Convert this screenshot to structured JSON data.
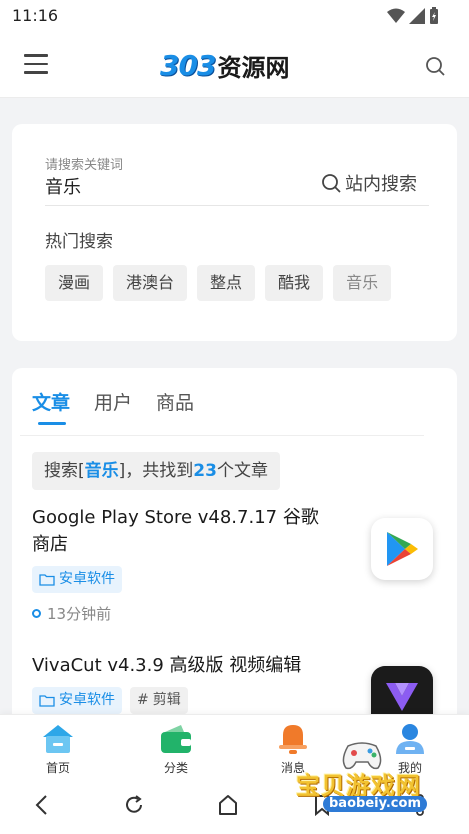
{
  "status": {
    "time": "11:16"
  },
  "header": {
    "logo_num": "303",
    "logo_text": "资源网",
    "menu_icon": "hamburger-menu-icon",
    "search_icon": "search-icon"
  },
  "search": {
    "placeholder": "请搜索关键词",
    "value": "音乐",
    "site_search_label": "站内搜索",
    "hot_label": "热门搜索",
    "hot_tags": [
      "漫画",
      "港澳台",
      "整点",
      "酷我",
      "音乐"
    ]
  },
  "results": {
    "tabs": [
      {
        "label": "文章",
        "active": true
      },
      {
        "label": "用户",
        "active": false
      },
      {
        "label": "商品",
        "active": false
      }
    ],
    "summary": {
      "prefix": "搜索[",
      "keyword": "音乐",
      "middle": "]，共找到",
      "count": "23",
      "suffix": "个文章"
    },
    "articles": [
      {
        "title": "Google Play Store v48.7.17 谷歌商店",
        "chips": [
          {
            "label": "安卓软件",
            "icon": "folder-icon"
          }
        ],
        "time": "13分钟前",
        "thumb": "google-play-icon"
      },
      {
        "title": "VivaCut v4.3.9 高级版 视频编辑",
        "chips": [
          {
            "label": "安卓软件",
            "icon": "folder-icon"
          },
          {
            "label": "剪辑",
            "icon": "hash-icon"
          }
        ],
        "thumb": "vivacut-icon"
      }
    ]
  },
  "bottom_nav": [
    {
      "label": "首页",
      "icon": "home-icon"
    },
    {
      "label": "分类",
      "icon": "wallet-icon"
    },
    {
      "label": "消息",
      "icon": "bell-icon"
    },
    {
      "label": "我的",
      "icon": "user-icon"
    }
  ],
  "watermark": {
    "text": "宝贝游戏网",
    "url": "baobeiy.com"
  },
  "colors": {
    "accent": "#1a8ee6",
    "home": "#2ea7e8",
    "category": "#22b36a",
    "message": "#f07a2a",
    "profile": "#2a86e0"
  }
}
